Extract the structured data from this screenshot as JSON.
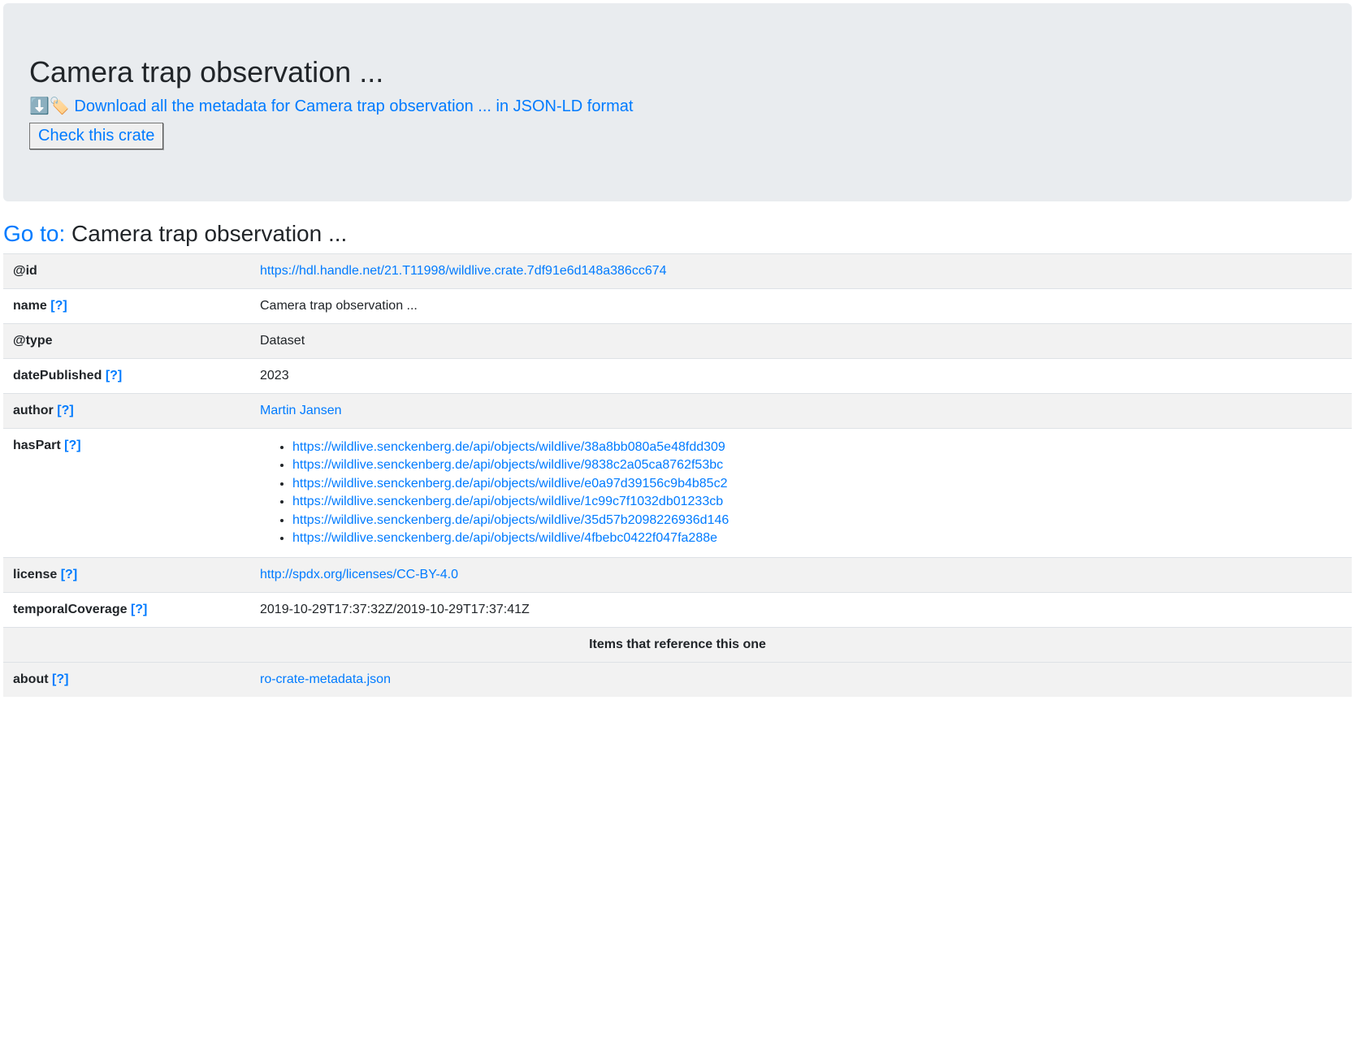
{
  "header": {
    "title": "Camera trap observation ...",
    "download_prefix": "⬇️🏷️ ",
    "download_text": "Download all the metadata for Camera trap observation ... in JSON-LD format",
    "check_button": "Check this crate"
  },
  "goto": {
    "label": "Go to:",
    "target": "Camera trap observation ..."
  },
  "rows": {
    "id": {
      "key": "@id",
      "value": "https://hdl.handle.net/21.T11998/wildlive.crate.7df91e6d148a386cc674"
    },
    "name": {
      "key": "name",
      "help": "[?]",
      "value": "Camera trap observation ..."
    },
    "type": {
      "key": "@type",
      "value": "Dataset"
    },
    "datePublished": {
      "key": "datePublished",
      "help": "[?]",
      "value": "2023"
    },
    "author": {
      "key": "author",
      "help": "[?]",
      "value": "Martin Jansen"
    },
    "hasPart": {
      "key": "hasPart",
      "help": "[?]",
      "items": [
        "https://wildlive.senckenberg.de/api/objects/wildlive/38a8bb080a5e48fdd309",
        "https://wildlive.senckenberg.de/api/objects/wildlive/9838c2a05ca8762f53bc",
        "https://wildlive.senckenberg.de/api/objects/wildlive/e0a97d39156c9b4b85c2",
        "https://wildlive.senckenberg.de/api/objects/wildlive/1c99c7f1032db01233cb",
        "https://wildlive.senckenberg.de/api/objects/wildlive/35d57b2098226936d146",
        "https://wildlive.senckenberg.de/api/objects/wildlive/4fbebc0422f047fa288e"
      ]
    },
    "license": {
      "key": "license",
      "help": "[?]",
      "value": "http://spdx.org/licenses/CC-BY-4.0"
    },
    "temporalCoverage": {
      "key": "temporalCoverage",
      "help": "[?]",
      "value": "2019-10-29T17:37:32Z/2019-10-29T17:37:41Z"
    },
    "sectionHeader": "Items that reference this one",
    "about": {
      "key": "about",
      "help": "[?]",
      "value": "ro-crate-metadata.json"
    }
  }
}
